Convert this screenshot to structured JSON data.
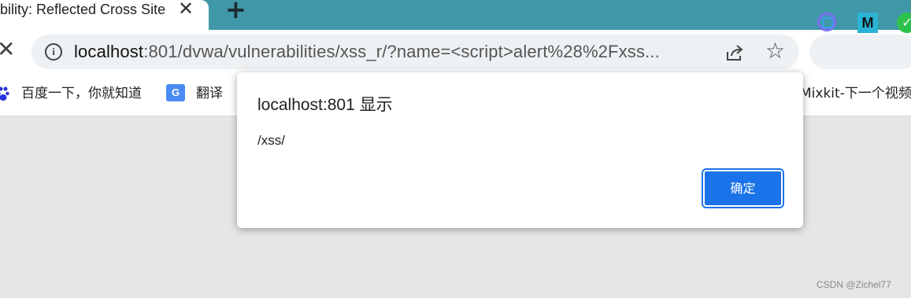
{
  "tab": {
    "title": "bility: Reflected Cross Site",
    "close_glyph": "✕",
    "new_tab_glyph": "+"
  },
  "toolbar": {
    "back_glyph": "✕",
    "url_host": "localhost",
    "url_rest": ":801/dvwa/vulnerabilities/xss_r/?name=<script>alert%28%2Fxss...",
    "info_glyph": "i",
    "star_glyph": "☆",
    "extensions": [
      {
        "name": "ext-ring-icon",
        "label": ""
      },
      {
        "name": "ext-m-icon",
        "label": "M"
      },
      {
        "name": "ext-check-icon",
        "label": "✓"
      }
    ]
  },
  "bookmarks": {
    "items": [
      {
        "label": "百度一下，你就知道",
        "icon": "baidu-paw-icon"
      },
      {
        "label": "翻译",
        "icon": "google-translate-icon",
        "icon_text": "G"
      },
      {
        "label": "Mixkit-下一个视频"
      }
    ]
  },
  "dialog": {
    "title": "localhost:801 显示",
    "message": "/xss/",
    "ok_label": "确定"
  },
  "watermark": "CSDN @Zichel77",
  "colors": {
    "tabstrip": "#4097a8",
    "omnibox": "#eef1f3",
    "button": "#1a73e8",
    "page_bg": "#e6e6e6"
  }
}
